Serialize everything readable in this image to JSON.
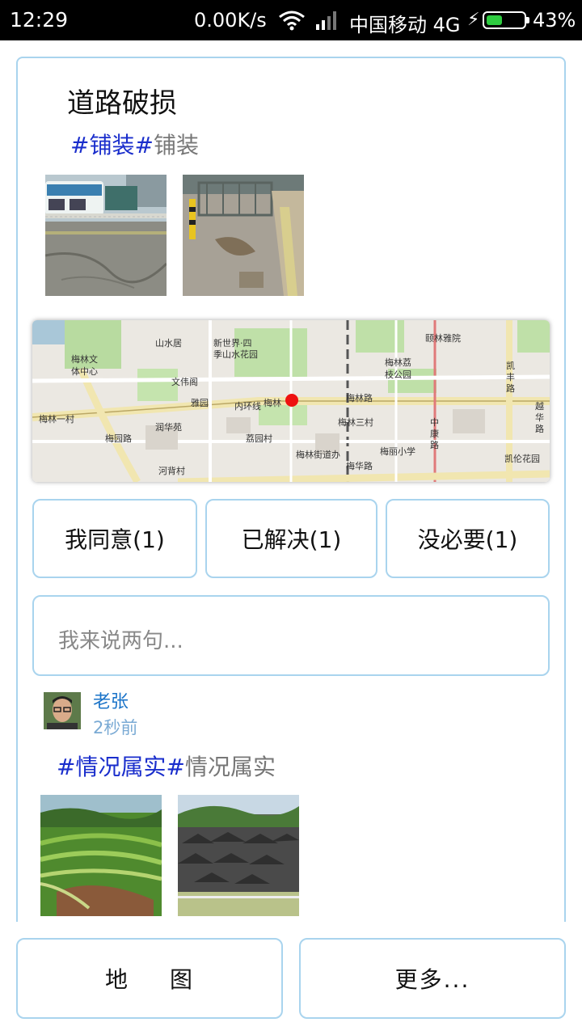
{
  "status_bar": {
    "time": "12:29",
    "net_speed": "0.00K/s",
    "carrier": "中国移动 4G",
    "battery_percent": "43%",
    "battery_level": 0.43,
    "icons": [
      "wifi-icon",
      "signal-icon",
      "charging-icon",
      "battery-icon"
    ]
  },
  "post": {
    "title": "道路破损",
    "tag_link": "#铺装#",
    "tag_text": "铺装",
    "photos": [
      "road-photo-bus-street",
      "road-photo-broken-sidewalk"
    ]
  },
  "map": {
    "labels": [
      "山水居",
      "新世界·四",
      "季山水花园",
      "颐林雅院",
      "梅林文",
      "体中心",
      "文伟阁",
      "梅林荔",
      "枝公园",
      "凯",
      "丰",
      "路",
      "雅园",
      "梅林路",
      "越",
      "华",
      "路",
      "梅林一村",
      "润华苑",
      "梅林三村",
      "中",
      "康",
      "路",
      "荔园村",
      "梅丽小学",
      "凯伦花园",
      "河背村",
      "梅林街道办",
      "梅华路",
      "梅园路",
      "内环线",
      "梅林"
    ],
    "pin_color": "#ee1111"
  },
  "actions": {
    "agree": "我同意(1)",
    "solved": "已解决(1)",
    "unnecessary": "没必要(1)"
  },
  "comment_input": {
    "placeholder": "我来说两句..."
  },
  "comment": {
    "user": "老张",
    "time": "2秒前",
    "tag_link": "#情况属实#",
    "tag_text": "情况属实",
    "photos": [
      "terraced-fields-photo",
      "village-photo"
    ]
  },
  "bottom_nav": {
    "map_left": "地",
    "map_right": "图",
    "more": "更多..."
  },
  "colors": {
    "accent_border": "#a9d4ee",
    "tag_link": "#1a2ecc",
    "user_name": "#1a73c8"
  }
}
